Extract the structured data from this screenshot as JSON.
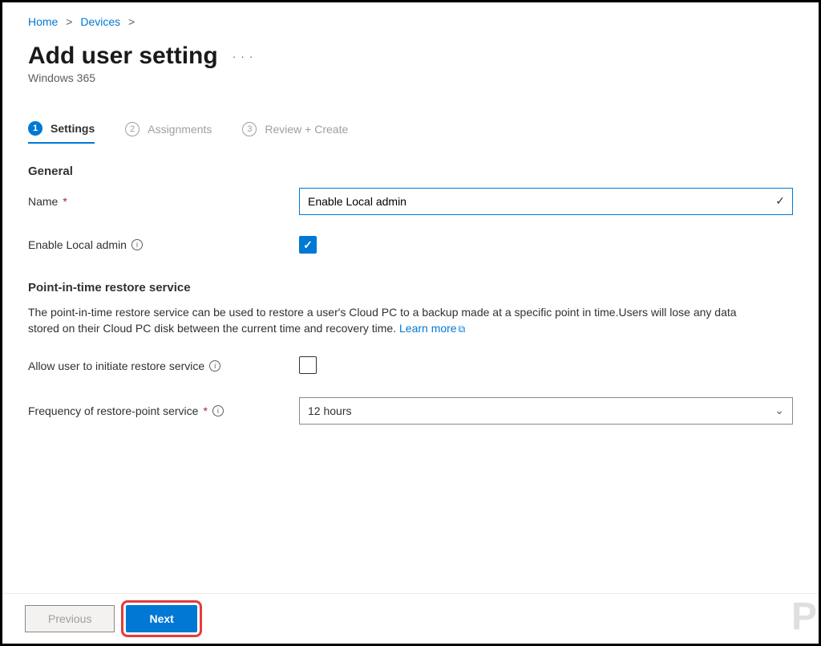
{
  "breadcrumb": {
    "home": "Home",
    "devices": "Devices"
  },
  "page": {
    "title": "Add user setting",
    "subtitle": "Windows 365"
  },
  "tabs": {
    "settings": {
      "num": "1",
      "label": "Settings"
    },
    "assignments": {
      "num": "2",
      "label": "Assignments"
    },
    "review": {
      "num": "3",
      "label": "Review + Create"
    }
  },
  "general": {
    "heading": "General",
    "name_label": "Name",
    "name_value": "Enable Local admin",
    "enable_local_admin_label": "Enable Local admin",
    "enable_local_admin_checked": true
  },
  "restore": {
    "heading": "Point-in-time restore service",
    "description": "The point-in-time restore service can be used to restore a user's Cloud PC to a backup made at a specific point in time.Users will lose any data stored on their Cloud PC disk between the current time and recovery time. ",
    "learn_more": "Learn more",
    "allow_label": "Allow user to initiate restore service",
    "allow_checked": false,
    "frequency_label": "Frequency of restore-point service",
    "frequency_value": "12 hours"
  },
  "footer": {
    "previous": "Previous",
    "next": "Next"
  },
  "watermark": "P"
}
